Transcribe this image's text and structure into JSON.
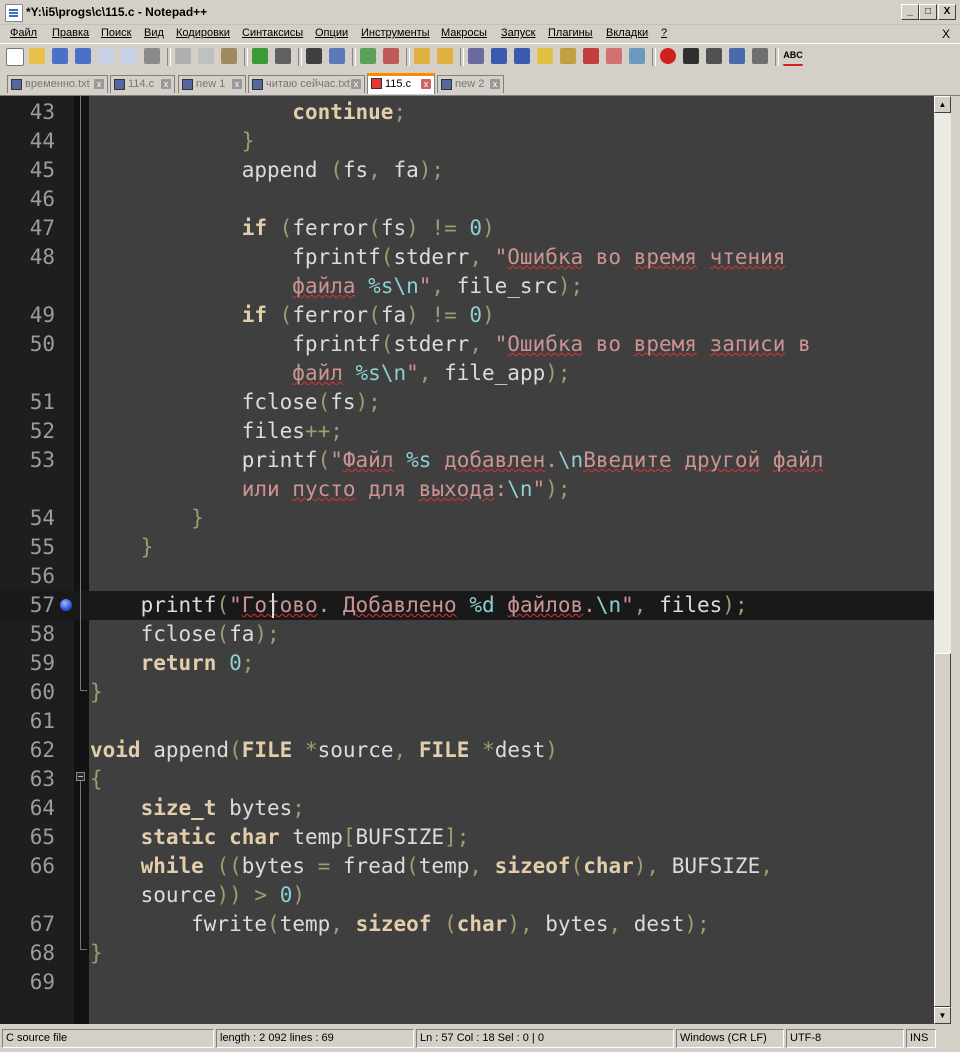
{
  "window": {
    "title": "*Y:\\i5\\progs\\c\\115.c - Notepad++",
    "minimize": "_",
    "restore": "□",
    "close": "X"
  },
  "menu": {
    "items": [
      "Файл",
      "Правка",
      "Поиск",
      "Вид",
      "Кодировки",
      "Синтаксисы",
      "Опции",
      "Инструменты",
      "Макросы",
      "Запуск",
      "Плагины",
      "Вкладки",
      "?"
    ],
    "close": "X"
  },
  "toolbar": {
    "spellcheck_label": "ABC"
  },
  "tabs": [
    {
      "label": "временно.txt",
      "active": false
    },
    {
      "label": "114.c",
      "active": false
    },
    {
      "label": "new 1",
      "active": false
    },
    {
      "label": "читаю сейчас.txt",
      "active": false
    },
    {
      "label": "115.c",
      "active": true
    },
    {
      "label": "new 2",
      "active": false
    }
  ],
  "editor": {
    "current_line": "57",
    "rows": [
      {
        "num": "43",
        "text": "                continue;"
      },
      {
        "num": "44",
        "text": "            }"
      },
      {
        "num": "45",
        "text": "            append (fs, fa);"
      },
      {
        "num": "46",
        "text": ""
      },
      {
        "num": "47",
        "text": "            if (ferror(fs) != 0)"
      },
      {
        "num": "48",
        "text": "                fprintf(stderr, \"Ошибка во время чтения"
      },
      {
        "num": "",
        "text": "                файла %s\\n\", file_src);"
      },
      {
        "num": "49",
        "text": "            if (ferror(fa) != 0)"
      },
      {
        "num": "50",
        "text": "                fprintf(stderr, \"Ошибка во время записи в"
      },
      {
        "num": "",
        "text": "                файл %s\\n\", file_app);"
      },
      {
        "num": "51",
        "text": "            fclose(fs);"
      },
      {
        "num": "52",
        "text": "            files++;"
      },
      {
        "num": "53",
        "text": "            printf(\"Файл %s добавлен.\\nВведите другой файл"
      },
      {
        "num": "",
        "text": "            или пусто для выхода:\\n\");"
      },
      {
        "num": "54",
        "text": "        }"
      },
      {
        "num": "55",
        "text": "    }"
      },
      {
        "num": "56",
        "text": ""
      },
      {
        "num": "57",
        "text": "    printf(\"Готово. Добавлено %d файлов.\\n\", files);"
      },
      {
        "num": "58",
        "text": "    fclose(fa);"
      },
      {
        "num": "59",
        "text": "    return 0;"
      },
      {
        "num": "60",
        "text": "}"
      },
      {
        "num": "61",
        "text": ""
      },
      {
        "num": "62",
        "text": "void append(FILE *source, FILE *dest)"
      },
      {
        "num": "63",
        "text": "{"
      },
      {
        "num": "64",
        "text": "    size_t bytes;"
      },
      {
        "num": "65",
        "text": "    static char temp[BUFSIZE];"
      },
      {
        "num": "66",
        "text": "    while ((bytes = fread(temp, sizeof(char), BUFSIZE,"
      },
      {
        "num": "",
        "text": "    source)) > 0)"
      },
      {
        "num": "67",
        "text": "        fwrite(temp, sizeof (char), bytes, dest);"
      },
      {
        "num": "68",
        "text": "}"
      },
      {
        "num": "69",
        "text": ""
      }
    ]
  },
  "statusbar": {
    "file_type": "C source file",
    "length": "length : 2 092    lines : 69",
    "position": "Ln : 57    Col : 18    Sel : 0 | 0",
    "eol": "Windows (CR LF)",
    "encoding": "UTF-8",
    "mode": "INS"
  },
  "colors": {
    "editor_bg": "#3f3f3f",
    "keyword": "#e3ceab",
    "string": "#cc9393",
    "number": "#8cd0d3",
    "operator": "#9f9d6d",
    "active_tab_accent": "#fa8a00",
    "bookmark": "#2c55d8"
  }
}
